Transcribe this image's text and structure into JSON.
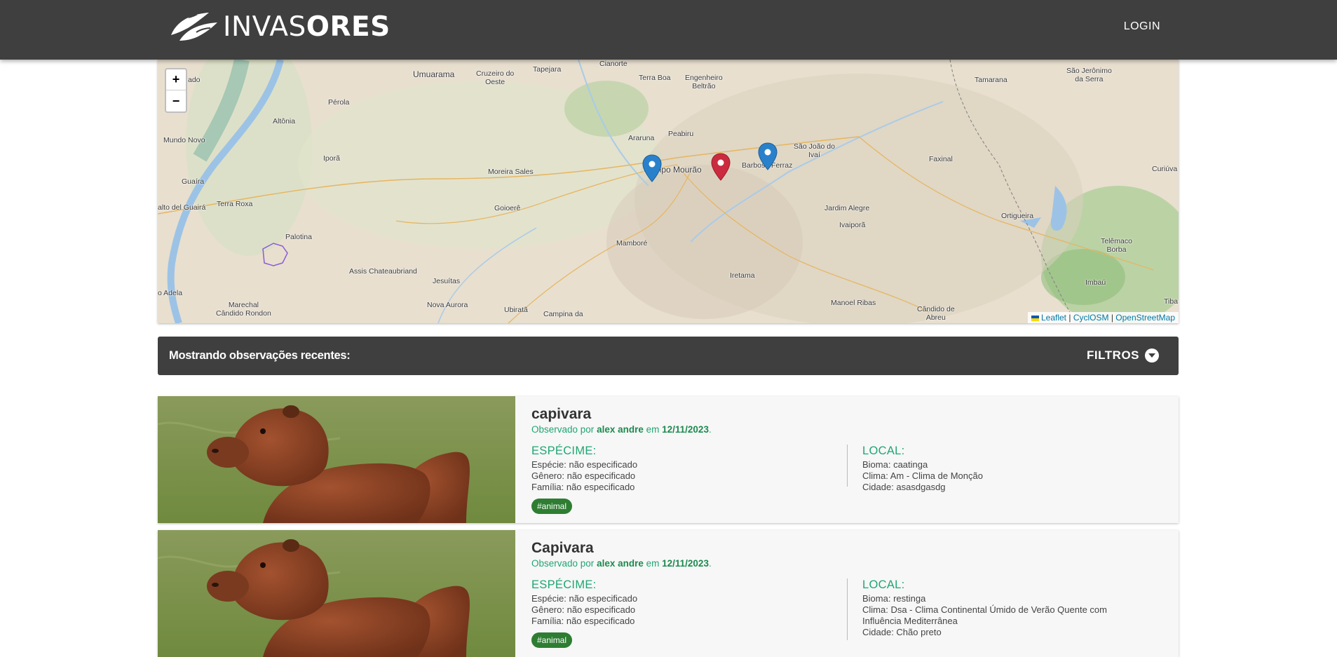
{
  "navbar": {
    "brand_light": "INVAS",
    "brand_bold": "ORES",
    "login_label": "LOGIN"
  },
  "map": {
    "zoom_in": "+",
    "zoom_out": "−",
    "places": {
      "cianorte": "Cianorte",
      "umuarama": "Umuarama",
      "cruzeiro": "Cruzeiro do\nOeste",
      "tapejara": "Tapejara",
      "terraboa": "Terra Boa",
      "engenheiro": "Engenheiro\nBeltrão",
      "perola": "Pérola",
      "altonia": "Altônia",
      "ado": "ado",
      "mundonovo": "Mundo Novo",
      "araruna": "Araruna",
      "peabiru": "Peabiru",
      "campomourao": "Campo Mourão",
      "barbosaferraz": "Barbosa Ferraz",
      "saojoaodoivai": "São João do\nIvaí",
      "ipora": "Iporã",
      "moreirasales": "Moreira Sales",
      "guaira": "Guaíra",
      "saltodoguaira": "alto del Guairá",
      "terraroxa": "Terra Roxa",
      "goioere": "Goioerê",
      "jardimalegre": "Jardim Alegre",
      "ivaipora": "Ivaiporã",
      "faxinal": "Faxinal",
      "ortigueira": "Ortigueira",
      "palotina": "Palotina",
      "mambore": "Mamboré",
      "assis": "Assis Chateaubriand",
      "jesuitas": "Jesuítas",
      "iretama": "Iretama",
      "adela": "o Adela",
      "marechal": "Marechal\nCândido Rondon",
      "novaaurora": "Nova Aurora",
      "ubirata": "Ubiratã",
      "campinada": "Campina da",
      "manoelribas": "Manoel Ribas",
      "candidodeabreu": "Cândido de\nAbreu",
      "tamarana": "Tamarana",
      "saojeronimo": "São Jerônimo\nda Serra",
      "curiuva": "Curiúva",
      "telemaco": "Telêmaco\nBorba",
      "imbau": "Imbaú",
      "tiba": "Tiba"
    },
    "attribution": {
      "leaflet": "Leaflet",
      "sep1": " | ",
      "cyclosm": "CyclOSM",
      "sep2": " | ",
      "osm": "OpenStreetMap"
    }
  },
  "filterbar": {
    "title": "Mostrando observações recentes:",
    "filters_label": "FILTROS"
  },
  "observations": [
    {
      "title": "capivara",
      "observed_prefix": "Observado por ",
      "observer": "alex andre",
      "observed_mid": " em ",
      "date": "12/11/2023",
      "observed_suffix": ".",
      "specimen_head": "ESPÉCIME:",
      "especie": "Espécie: não especificado",
      "genero": "Gênero: não especificado",
      "familia": "Família: não especificado",
      "local_head": "LOCAL:",
      "bioma": "Bioma: caatinga",
      "clima": "Clima: Am - Clima de Monção",
      "cidade": "Cidade: asasdgasdg",
      "tag": "#animal"
    },
    {
      "title": "Capivara",
      "observed_prefix": "Observado por ",
      "observer": "alex andre",
      "observed_mid": " em ",
      "date": "12/11/2023",
      "observed_suffix": ".",
      "specimen_head": "ESPÉCIME:",
      "especie": "Espécie: não especificado",
      "genero": "Gênero: não especificado",
      "familia": "Família: não especificado",
      "local_head": "LOCAL:",
      "bioma": "Bioma: restinga",
      "clima": "Clima: Dsa - Clima Continental Úmido de Verão Quente com\nInfluência Mediterrânea",
      "cidade": "Cidade: Chão preto",
      "tag": "#animal"
    }
  ],
  "colors": {
    "navbar": "#3f3f3f",
    "accent_green": "#1ea672",
    "tag_green": "#2e7d32",
    "marker_blue": "#2a81cb",
    "marker_red": "#cb2b3e"
  }
}
